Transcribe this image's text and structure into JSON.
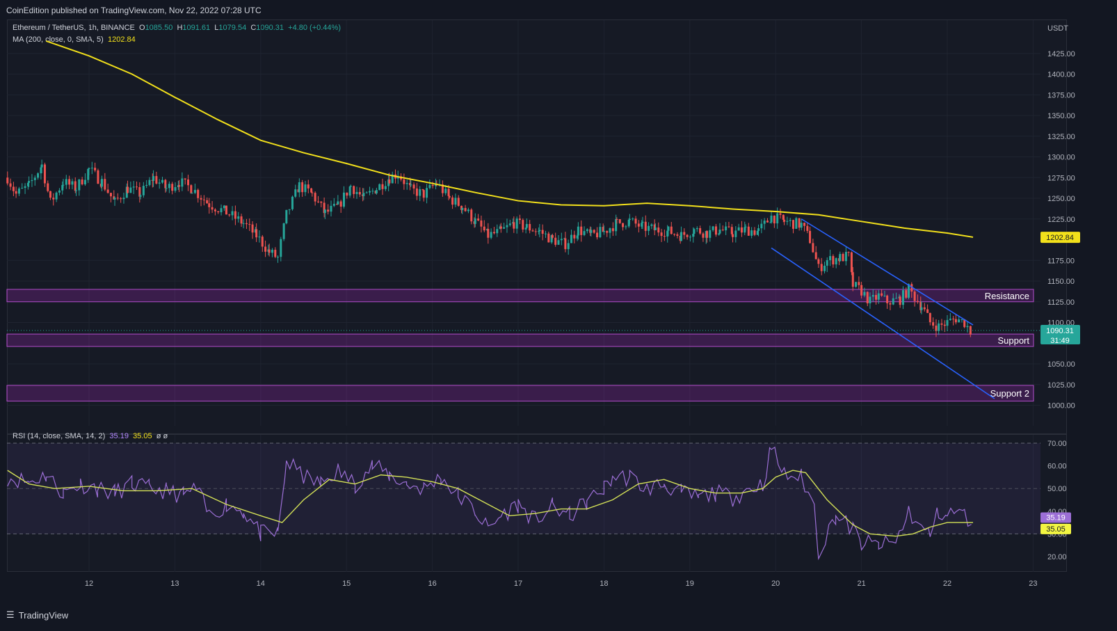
{
  "header": {
    "publisher": "CoinEdition published on TradingView.com, Nov 22, 2022 07:28 UTC"
  },
  "legend": {
    "symbol": "Ethereum / TetherUS, 1h, BINANCE",
    "o_label": "O",
    "o_value": "1085.50",
    "h_label": "H",
    "h_value": "1091.61",
    "l_label": "L",
    "l_value": "1079.54",
    "c_label": "C",
    "c_value": "1090.31",
    "change": "+4.80 (+0.44%)",
    "ma_label": "MA (200, close, 0, SMA, 5)",
    "ma_value": "1202.84",
    "rsi_label": "RSI (14, close, SMA, 14, 2)",
    "rsi_value": "35.19",
    "rsi_ma_value": "35.05",
    "rsi_extra": "ø ø"
  },
  "footer": {
    "brand": "TradingView"
  },
  "colors": {
    "up": "#26a69a",
    "down": "#ef5350",
    "ma": "#f2e01b",
    "rsi": "#9c6fd6",
    "rsi_ma": "#d4e157",
    "zone": "#9c27b0",
    "channel": "#2962ff",
    "bg": "#161a25"
  },
  "chart_data": [
    {
      "type": "candlestick",
      "title": "Ethereum / TetherUS, 1h, BINANCE",
      "y_unit": "USDT",
      "ylim": [
        990,
        1440
      ],
      "y_ticks": [
        1000,
        1025,
        1050,
        1100,
        1125,
        1150,
        1175,
        1225,
        1250,
        1275,
        1300,
        1325,
        1350,
        1375,
        1400,
        1425
      ],
      "x_ticks": [
        "12",
        "13",
        "14",
        "15",
        "16",
        "17",
        "18",
        "19",
        "20",
        "21",
        "22",
        "23"
      ],
      "x_range": [
        11.05,
        23.0
      ],
      "close_path": [
        [
          11.05,
          1275
        ],
        [
          11.15,
          1255
        ],
        [
          11.3,
          1265
        ],
        [
          11.45,
          1290
        ],
        [
          11.55,
          1245
        ],
        [
          11.7,
          1270
        ],
        [
          11.85,
          1262
        ],
        [
          12.0,
          1285
        ],
        [
          12.15,
          1270
        ],
        [
          12.3,
          1245
        ],
        [
          12.45,
          1262
        ],
        [
          12.6,
          1255
        ],
        [
          12.75,
          1275
        ],
        [
          12.9,
          1262
        ],
        [
          13.05,
          1270
        ],
        [
          13.2,
          1262
        ],
        [
          13.4,
          1243
        ],
        [
          13.6,
          1233
        ],
        [
          13.8,
          1220
        ],
        [
          13.95,
          1205
        ],
        [
          14.1,
          1185
        ],
        [
          14.2,
          1178
        ],
        [
          14.3,
          1230
        ],
        [
          14.45,
          1265
        ],
        [
          14.6,
          1255
        ],
        [
          14.75,
          1232
        ],
        [
          14.9,
          1240
        ],
        [
          15.05,
          1265
        ],
        [
          15.2,
          1250
        ],
        [
          15.35,
          1262
        ],
        [
          15.5,
          1275
        ],
        [
          15.6,
          1280
        ],
        [
          15.75,
          1260
        ],
        [
          15.9,
          1255
        ],
        [
          16.05,
          1268
        ],
        [
          16.2,
          1250
        ],
        [
          16.35,
          1240
        ],
        [
          16.5,
          1222
        ],
        [
          16.65,
          1205
        ],
        [
          16.8,
          1210
        ],
        [
          16.95,
          1220
        ],
        [
          17.1,
          1215
        ],
        [
          17.25,
          1210
        ],
        [
          17.4,
          1200
        ],
        [
          17.55,
          1195
        ],
        [
          17.7,
          1212
        ],
        [
          17.85,
          1205
        ],
        [
          18.0,
          1210
        ],
        [
          18.15,
          1220
        ],
        [
          18.3,
          1222
        ],
        [
          18.45,
          1215
        ],
        [
          18.6,
          1212
        ],
        [
          18.75,
          1210
        ],
        [
          18.9,
          1205
        ],
        [
          19.05,
          1212
        ],
        [
          19.2,
          1208
        ],
        [
          19.35,
          1212
        ],
        [
          19.5,
          1208
        ],
        [
          19.65,
          1212
        ],
        [
          19.8,
          1210
        ],
        [
          19.95,
          1228
        ],
        [
          20.1,
          1222
        ],
        [
          20.3,
          1218
        ],
        [
          20.4,
          1200
        ],
        [
          20.5,
          1165
        ],
        [
          20.6,
          1175
        ],
        [
          20.75,
          1178
        ],
        [
          20.85,
          1180
        ],
        [
          20.9,
          1145
        ],
        [
          21.0,
          1138
        ],
        [
          21.1,
          1125
        ],
        [
          21.2,
          1132
        ],
        [
          21.3,
          1125
        ],
        [
          21.45,
          1128
        ],
        [
          21.55,
          1140
        ],
        [
          21.7,
          1120
        ],
        [
          21.8,
          1100
        ],
        [
          21.9,
          1095
        ],
        [
          22.0,
          1100
        ],
        [
          22.1,
          1105
        ],
        [
          22.2,
          1100
        ],
        [
          22.3,
          1085
        ]
      ],
      "series": [
        {
          "name": "MA (200, close, 0, SMA, 5)",
          "points": [
            [
              11.5,
              1440
            ],
            [
              12.0,
              1422
            ],
            [
              12.5,
              1400
            ],
            [
              13.0,
              1372
            ],
            [
              13.5,
              1345
            ],
            [
              14.0,
              1320
            ],
            [
              14.5,
              1305
            ],
            [
              15.0,
              1292
            ],
            [
              15.5,
              1278
            ],
            [
              16.0,
              1268
            ],
            [
              16.5,
              1257
            ],
            [
              17.0,
              1247
            ],
            [
              17.5,
              1242
            ],
            [
              18.0,
              1241
            ],
            [
              18.5,
              1244
            ],
            [
              19.0,
              1241
            ],
            [
              19.5,
              1237
            ],
            [
              20.0,
              1234
            ],
            [
              20.5,
              1230
            ],
            [
              21.0,
              1222
            ],
            [
              21.5,
              1214
            ],
            [
              22.0,
              1208
            ],
            [
              22.3,
              1203
            ]
          ]
        }
      ],
      "zones": [
        {
          "label": "Resistance",
          "low": 1125,
          "high": 1140
        },
        {
          "label": "Support",
          "low": 1071,
          "high": 1086
        },
        {
          "label": "Support 2",
          "low": 1005,
          "high": 1024
        }
      ],
      "channel": {
        "upper": [
          [
            20.3,
            1225
          ],
          [
            22.3,
            1097
          ]
        ],
        "lower": [
          [
            19.95,
            1190
          ],
          [
            22.55,
            1008
          ]
        ]
      },
      "price_labels": [
        {
          "value": "1202.84",
          "at": 1202.84,
          "color": "#f2e01b"
        },
        {
          "value": "1090.31",
          "at": 1090.31,
          "color": "#26a69a"
        }
      ],
      "countdown": "31:49"
    },
    {
      "type": "line",
      "title": "RSI (14, close, SMA, 14, 2)",
      "ylim": [
        15,
        72
      ],
      "y_ticks": [
        20,
        30,
        40,
        50,
        60,
        70
      ],
      "bands": {
        "upper": 70,
        "middle": 50,
        "lower": 30
      },
      "series": [
        {
          "name": "RSI",
          "points": [
            [
              11.05,
              55
            ],
            [
              11.3,
              53
            ],
            [
              11.5,
              56
            ],
            [
              11.7,
              48
            ],
            [
              11.9,
              52
            ],
            [
              12.1,
              50
            ],
            [
              12.3,
              48
            ],
            [
              12.5,
              52
            ],
            [
              12.7,
              50
            ],
            [
              12.9,
              49
            ],
            [
              13.1,
              47
            ],
            [
              13.25,
              50
            ],
            [
              13.4,
              38
            ],
            [
              13.6,
              43
            ],
            [
              13.8,
              40
            ],
            [
              14.0,
              30
            ],
            [
              14.2,
              30
            ],
            [
              14.3,
              62
            ],
            [
              14.5,
              55
            ],
            [
              14.7,
              52
            ],
            [
              14.9,
              58
            ],
            [
              15.1,
              52
            ],
            [
              15.3,
              60
            ],
            [
              15.5,
              56
            ],
            [
              15.7,
              52
            ],
            [
              15.9,
              50
            ],
            [
              16.1,
              55
            ],
            [
              16.3,
              47
            ],
            [
              16.5,
              40
            ],
            [
              16.65,
              32
            ],
            [
              16.8,
              38
            ],
            [
              17.0,
              43
            ],
            [
              17.2,
              36
            ],
            [
              17.4,
              42
            ],
            [
              17.6,
              38
            ],
            [
              17.8,
              44
            ],
            [
              18.0,
              50
            ],
            [
              18.1,
              55
            ],
            [
              18.3,
              55
            ],
            [
              18.5,
              50
            ],
            [
              18.7,
              52
            ],
            [
              18.9,
              48
            ],
            [
              19.1,
              46
            ],
            [
              19.3,
              48
            ],
            [
              19.5,
              46
            ],
            [
              19.7,
              50
            ],
            [
              19.85,
              52
            ],
            [
              19.95,
              68
            ],
            [
              20.1,
              56
            ],
            [
              20.3,
              55
            ],
            [
              20.45,
              42
            ],
            [
              20.5,
              22
            ],
            [
              20.7,
              38
            ],
            [
              20.9,
              32
            ],
            [
              21.0,
              26
            ],
            [
              21.2,
              25
            ],
            [
              21.4,
              26
            ],
            [
              21.55,
              40
            ],
            [
              21.7,
              32
            ],
            [
              21.8,
              30
            ],
            [
              21.9,
              40
            ],
            [
              22.0,
              38
            ],
            [
              22.1,
              40
            ],
            [
              22.2,
              38
            ],
            [
              22.3,
              35
            ]
          ]
        },
        {
          "name": "RSI MA",
          "points": [
            [
              11.05,
              58
            ],
            [
              11.3,
              52
            ],
            [
              11.6,
              50
            ],
            [
              12.0,
              51
            ],
            [
              12.4,
              49
            ],
            [
              12.8,
              49
            ],
            [
              13.2,
              50
            ],
            [
              13.6,
              43
            ],
            [
              14.0,
              38
            ],
            [
              14.25,
              35
            ],
            [
              14.5,
              45
            ],
            [
              14.8,
              54
            ],
            [
              15.1,
              52
            ],
            [
              15.4,
              56
            ],
            [
              15.7,
              55
            ],
            [
              16.0,
              53
            ],
            [
              16.3,
              50
            ],
            [
              16.6,
              44
            ],
            [
              16.9,
              38
            ],
            [
              17.2,
              39
            ],
            [
              17.5,
              41
            ],
            [
              17.8,
              41
            ],
            [
              18.1,
              45
            ],
            [
              18.4,
              52
            ],
            [
              18.7,
              54
            ],
            [
              19.0,
              50
            ],
            [
              19.3,
              48
            ],
            [
              19.6,
              48
            ],
            [
              19.85,
              50
            ],
            [
              20.0,
              55
            ],
            [
              20.2,
              58
            ],
            [
              20.35,
              57
            ],
            [
              20.6,
              45
            ],
            [
              20.9,
              34
            ],
            [
              21.1,
              30
            ],
            [
              21.4,
              29
            ],
            [
              21.6,
              30
            ],
            [
              21.8,
              33
            ],
            [
              22.0,
              35
            ],
            [
              22.3,
              35
            ]
          ]
        }
      ]
    }
  ]
}
